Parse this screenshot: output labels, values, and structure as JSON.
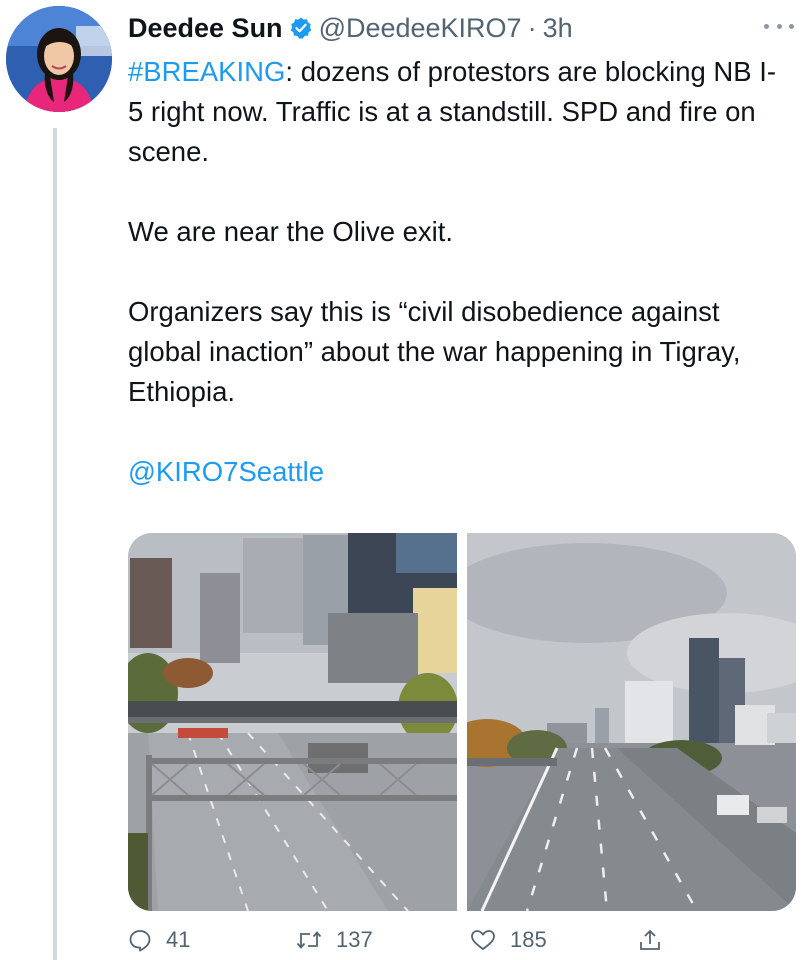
{
  "tweet": {
    "author_name": "Deedee Sun",
    "handle": "@DeedeeKIRO7",
    "separator": "·",
    "time": "3h",
    "hashtag": "#BREAKING",
    "line1_rest": ": dozens of protestors are blocking NB I-5 right now. Traffic is at a standstill. SPD and fire on scene.",
    "para2": "We are near the Olive exit.",
    "para3": "Organizers say this is “civil disobedience against global inaction” about the war happening in Tigray, Ethiopia.",
    "mention": "@KIRO7Seattle"
  },
  "actions": {
    "replies": "41",
    "retweets": "137",
    "likes": "185"
  },
  "colors": {
    "link": "#1d9bf0",
    "secondary_text": "#536471",
    "verified": "#1d9bf0"
  },
  "icons": [
    "verified-badge-icon",
    "more-icon",
    "reply-icon",
    "retweet-icon",
    "like-icon",
    "share-icon"
  ]
}
